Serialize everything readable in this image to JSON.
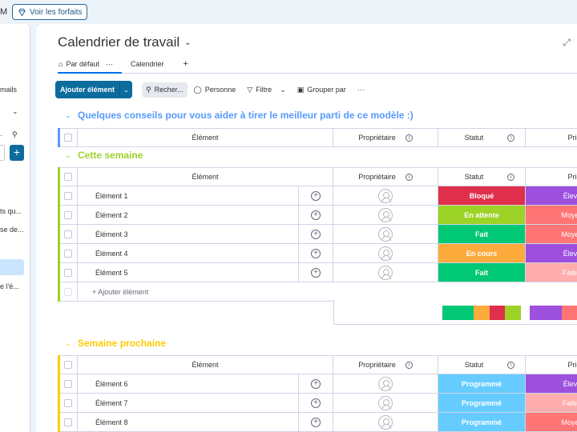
{
  "topbar": {
    "left_fragment": "M",
    "plans_label": "Voir les forfaits"
  },
  "side": {
    "fragments": [
      "mails",
      "ts qu...",
      "se de...",
      "e l'é..."
    ]
  },
  "board": {
    "title": "Calendrier de travail"
  },
  "views": [
    {
      "label": "Par défaut",
      "active": true
    },
    {
      "label": "Calendrier",
      "active": false
    }
  ],
  "toolbar": {
    "add": "Ajouter élément",
    "search": "Recher...",
    "person": "Personne",
    "filter": "Filtre",
    "group": "Grouper par"
  },
  "columns": {
    "item": "Élément",
    "owner": "Propriétaire",
    "status": "Statut",
    "priority": "Priorit"
  },
  "groups": [
    {
      "title": "Quelques conseils pour vous aider à tirer le meilleur parti de ce modèle :)",
      "color": "#579bfc",
      "items": []
    },
    {
      "title": "Cette semaine",
      "color": "#9cd326",
      "items": [
        {
          "name": "Élément 1",
          "status": "Bloqué",
          "status_color": "#df2f4a",
          "priority": "Élevé",
          "priority_color": "#9d50dd"
        },
        {
          "name": "Élément 2",
          "status": "En attente",
          "status_color": "#9cd326",
          "priority": "Moyen",
          "priority_color": "#ff7575"
        },
        {
          "name": "Élément 3",
          "status": "Fait",
          "status_color": "#00c875",
          "priority": "Moyen",
          "priority_color": "#ff7575"
        },
        {
          "name": "Élément 4",
          "status": "En cours",
          "status_color": "#fdab3d",
          "priority": "Élevé",
          "priority_color": "#9d50dd"
        },
        {
          "name": "Élément 5",
          "status": "Fait",
          "status_color": "#00c875",
          "priority": "Faible",
          "priority_color": "#ffadad"
        }
      ],
      "add_label": "+ Ajouter élément"
    },
    {
      "title": "Semaine prochaine",
      "color": "#ffcb00",
      "items": [
        {
          "name": "Élément 6",
          "status": "Programmé",
          "status_color": "#66ccff",
          "priority": "Élevé",
          "priority_color": "#9d50dd"
        },
        {
          "name": "Élément 7",
          "status": "Programmé",
          "status_color": "#66ccff",
          "priority": "Faible",
          "priority_color": "#ffadad"
        },
        {
          "name": "Élément 8",
          "status": "Programmé",
          "status_color": "#66ccff",
          "priority": "Moyen",
          "priority_color": "#ff7575"
        }
      ]
    }
  ],
  "summary": {
    "status": [
      {
        "c": "#00c875",
        "w": 2
      },
      {
        "c": "#fdab3d",
        "w": 1
      },
      {
        "c": "#df2f4a",
        "w": 1
      },
      {
        "c": "#9cd326",
        "w": 1
      }
    ],
    "priority": [
      {
        "c": "#9d50dd",
        "w": 2
      },
      {
        "c": "#ff7575",
        "w": 2
      }
    ]
  }
}
